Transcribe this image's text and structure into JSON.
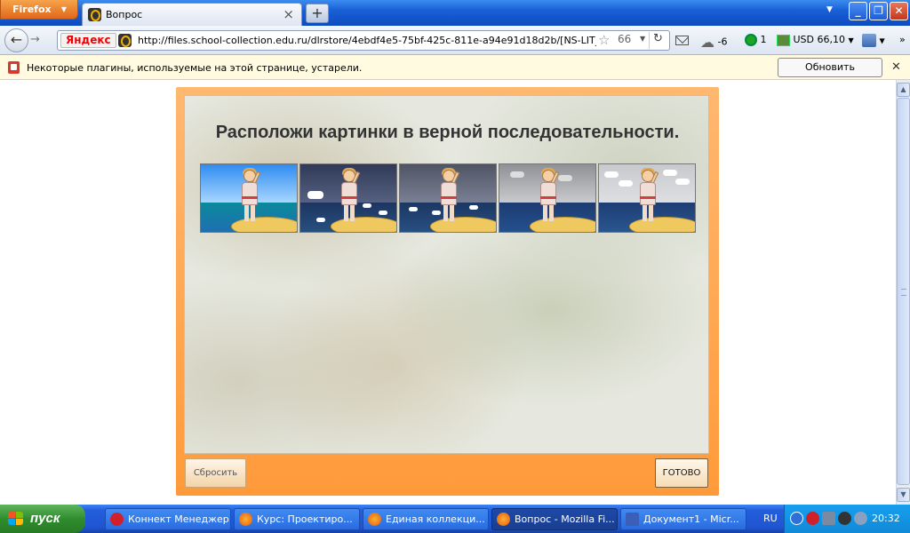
{
  "browser": {
    "app_button": "Firefox",
    "tab_title": "Вопрос",
    "url": "http://files.school-collection.edu.ru/dlrstore/4ebdf4e5-75bf-425c-811e-a94e91d18d2b/[NS-LIT_2-02]_[ID...",
    "search_brand": "Яндекс",
    "weather": "-6",
    "notifications_count": "1",
    "currency": "USD 66,10"
  },
  "notice": {
    "text": "Некоторые плагины, используемые на этой странице, устарели.",
    "button": "Обновить плагины..."
  },
  "exercise": {
    "title": "Расположи картинки в верной последовательности.",
    "cards": [
      {
        "name": "calm-sea"
      },
      {
        "name": "storm"
      },
      {
        "name": "dark-sea"
      },
      {
        "name": "grey-sky"
      },
      {
        "name": "clouds"
      }
    ],
    "reset_button": "Сбросить",
    "done_button": "готово"
  },
  "taskbar": {
    "start": "пуск",
    "tasks": [
      {
        "label": "Коннект Менеджер"
      },
      {
        "label": "Курс: Проектиро..."
      },
      {
        "label": "Единая коллекци..."
      },
      {
        "label": "Вопрос - Mozilla Fi..."
      },
      {
        "label": "Документ1 - Micr..."
      }
    ],
    "lang": "RU",
    "clock": "20:32"
  }
}
